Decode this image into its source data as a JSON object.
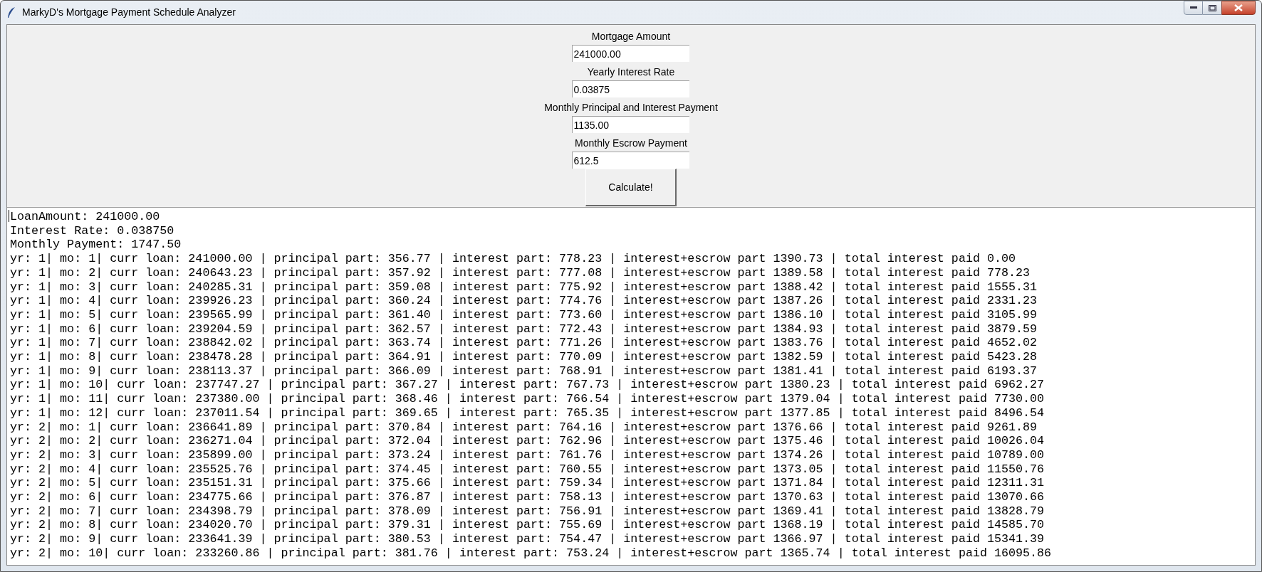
{
  "window": {
    "title": "MarkyD's Mortgage Payment Schedule Analyzer"
  },
  "fields": [
    {
      "label": "Mortgage Amount",
      "value": "241000.00"
    },
    {
      "label": "Yearly Interest Rate",
      "value": "0.03875"
    },
    {
      "label": "Monthly Principal and Interest Payment",
      "value": "1135.00"
    },
    {
      "label": "Monthly Escrow Payment",
      "value": "612.5"
    }
  ],
  "calculate_button": "Calculate!",
  "output_lines": [
    "LoanAmount: 241000.00",
    "Interest Rate: 0.038750",
    "Monthly Payment: 1747.50",
    "yr: 1| mo: 1| curr loan: 241000.00 | principal part: 356.77 | interest part: 778.23 | interest+escrow part 1390.73 | total interest paid 0.00",
    "yr: 1| mo: 2| curr loan: 240643.23 | principal part: 357.92 | interest part: 777.08 | interest+escrow part 1389.58 | total interest paid 778.23",
    "yr: 1| mo: 3| curr loan: 240285.31 | principal part: 359.08 | interest part: 775.92 | interest+escrow part 1388.42 | total interest paid 1555.31",
    "yr: 1| mo: 4| curr loan: 239926.23 | principal part: 360.24 | interest part: 774.76 | interest+escrow part 1387.26 | total interest paid 2331.23",
    "yr: 1| mo: 5| curr loan: 239565.99 | principal part: 361.40 | interest part: 773.60 | interest+escrow part 1386.10 | total interest paid 3105.99",
    "yr: 1| mo: 6| curr loan: 239204.59 | principal part: 362.57 | interest part: 772.43 | interest+escrow part 1384.93 | total interest paid 3879.59",
    "yr: 1| mo: 7| curr loan: 238842.02 | principal part: 363.74 | interest part: 771.26 | interest+escrow part 1383.76 | total interest paid 4652.02",
    "yr: 1| mo: 8| curr loan: 238478.28 | principal part: 364.91 | interest part: 770.09 | interest+escrow part 1382.59 | total interest paid 5423.28",
    "yr: 1| mo: 9| curr loan: 238113.37 | principal part: 366.09 | interest part: 768.91 | interest+escrow part 1381.41 | total interest paid 6193.37",
    "yr: 1| mo: 10| curr loan: 237747.27 | principal part: 367.27 | interest part: 767.73 | interest+escrow part 1380.23 | total interest paid 6962.27",
    "yr: 1| mo: 11| curr loan: 237380.00 | principal part: 368.46 | interest part: 766.54 | interest+escrow part 1379.04 | total interest paid 7730.00",
    "yr: 1| mo: 12| curr loan: 237011.54 | principal part: 369.65 | interest part: 765.35 | interest+escrow part 1377.85 | total interest paid 8496.54",
    "yr: 2| mo: 1| curr loan: 236641.89 | principal part: 370.84 | interest part: 764.16 | interest+escrow part 1376.66 | total interest paid 9261.89",
    "yr: 2| mo: 2| curr loan: 236271.04 | principal part: 372.04 | interest part: 762.96 | interest+escrow part 1375.46 | total interest paid 10026.04",
    "yr: 2| mo: 3| curr loan: 235899.00 | principal part: 373.24 | interest part: 761.76 | interest+escrow part 1374.26 | total interest paid 10789.00",
    "yr: 2| mo: 4| curr loan: 235525.76 | principal part: 374.45 | interest part: 760.55 | interest+escrow part 1373.05 | total interest paid 11550.76",
    "yr: 2| mo: 5| curr loan: 235151.31 | principal part: 375.66 | interest part: 759.34 | interest+escrow part 1371.84 | total interest paid 12311.31",
    "yr: 2| mo: 6| curr loan: 234775.66 | principal part: 376.87 | interest part: 758.13 | interest+escrow part 1370.63 | total interest paid 13070.66",
    "yr: 2| mo: 7| curr loan: 234398.79 | principal part: 378.09 | interest part: 756.91 | interest+escrow part 1369.41 | total interest paid 13828.79",
    "yr: 2| mo: 8| curr loan: 234020.70 | principal part: 379.31 | interest part: 755.69 | interest+escrow part 1368.19 | total interest paid 14585.70",
    "yr: 2| mo: 9| curr loan: 233641.39 | principal part: 380.53 | interest part: 754.47 | interest+escrow part 1366.97 | total interest paid 15341.39",
    "yr: 2| mo: 10| curr loan: 233260.86 | principal part: 381.76 | interest part: 753.24 | interest+escrow part 1365.74 | total interest paid 16095.86"
  ]
}
